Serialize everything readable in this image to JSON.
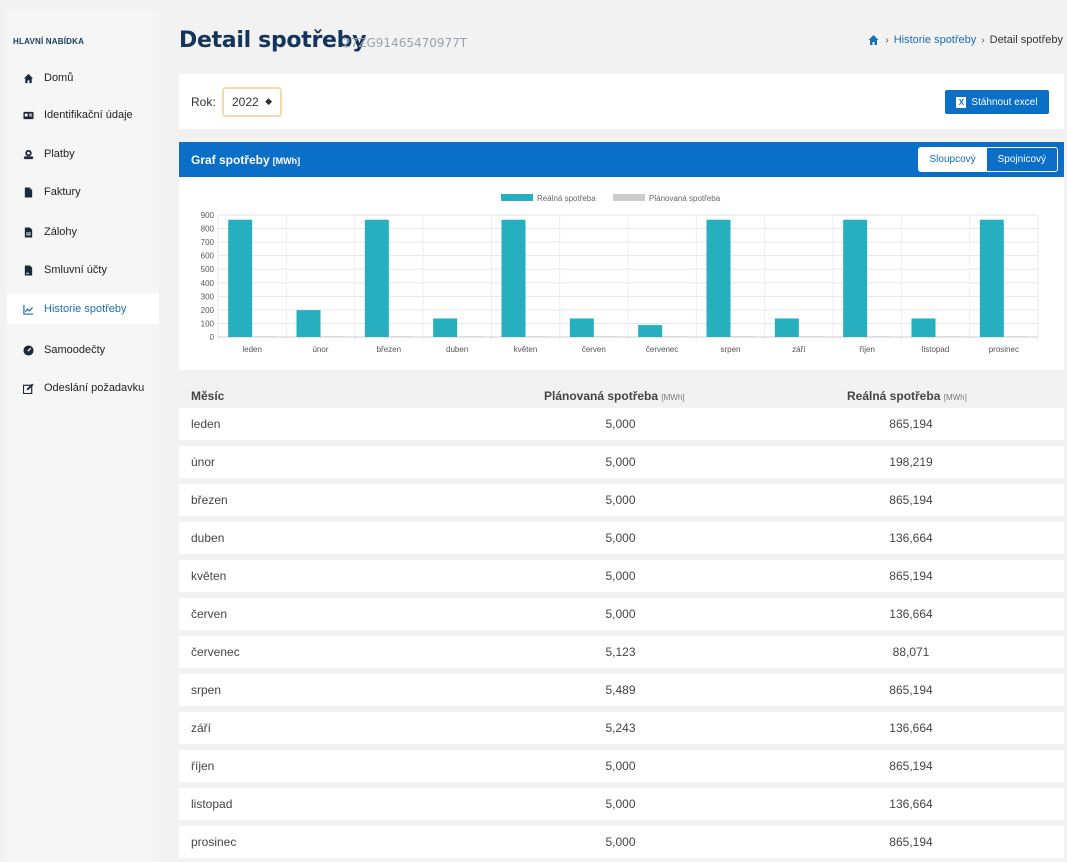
{
  "sidebar": {
    "header": "HLAVNÍ NABÍDKA",
    "items": [
      {
        "label": "Domů",
        "icon": "home-icon"
      },
      {
        "label": "Identifikační údaje",
        "icon": "id-card-icon"
      },
      {
        "label": "Platby",
        "icon": "payment-icon"
      },
      {
        "label": "Faktury",
        "icon": "invoice-icon"
      },
      {
        "label": "Zálohy",
        "icon": "deposit-icon"
      },
      {
        "label": "Smluvní účty",
        "icon": "contract-icon"
      },
      {
        "label": "Historie spotřeby",
        "icon": "line-chart-icon",
        "active": true
      },
      {
        "label": "Samoodečty",
        "icon": "gauge-icon"
      },
      {
        "label": "Odeslání požadavku",
        "icon": "edit-icon"
      }
    ]
  },
  "header": {
    "title": "Detail spotřeby",
    "subtitle": "27ZG91465470977T"
  },
  "breadcrumb": {
    "link": "Historie spotřeby",
    "current": "Detail spotřeby"
  },
  "filter": {
    "label": "Rok:",
    "year": "2022",
    "download_label": "Stáhnout excel"
  },
  "chart_card": {
    "title": "Graf spotřeby",
    "unit": "[MWh]",
    "toggle_bar": "Sloupcový",
    "toggle_line": "Spojnicový"
  },
  "chart_data": {
    "type": "bar",
    "categories": [
      "leden",
      "únor",
      "březen",
      "duben",
      "květen",
      "červen",
      "červenec",
      "srpen",
      "září",
      "říjen",
      "listopad",
      "prosinec"
    ],
    "series": [
      {
        "name": "Reálná spotřeba",
        "color": "#26afbf",
        "values": [
          865.194,
          198.219,
          865.194,
          136.664,
          865.194,
          136.664,
          88.071,
          865.194,
          136.664,
          865.194,
          136.664,
          865.194
        ]
      },
      {
        "name": "Plánovaná spotřeba",
        "color": "#cccccc",
        "values": [
          5.0,
          5.0,
          5.0,
          5.0,
          5.0,
          5.0,
          5.123,
          5.489,
          5.243,
          5.0,
          5.0,
          5.0
        ]
      }
    ],
    "yticks": [
      "900",
      "800",
      "700",
      "600",
      "500",
      "400",
      "300",
      "200",
      "100",
      "0"
    ],
    "ylim": [
      0,
      900
    ],
    "legend": "top-center",
    "grid": true
  },
  "table": {
    "col_month": "Měsíc",
    "col_planned": "Plánovaná spotřeba",
    "col_real": "Reálná spotřeba",
    "unit": "[MWh]",
    "rows": [
      {
        "month": "leden",
        "planned": "5,000",
        "real": "865,194"
      },
      {
        "month": "únor",
        "planned": "5,000",
        "real": "198,219"
      },
      {
        "month": "březen",
        "planned": "5,000",
        "real": "865,194"
      },
      {
        "month": "duben",
        "planned": "5,000",
        "real": "136,664"
      },
      {
        "month": "květen",
        "planned": "5,000",
        "real": "865,194"
      },
      {
        "month": "červen",
        "planned": "5,000",
        "real": "136,664"
      },
      {
        "month": "červenec",
        "planned": "5,123",
        "real": "88,071"
      },
      {
        "month": "srpen",
        "planned": "5,489",
        "real": "865,194"
      },
      {
        "month": "září",
        "planned": "5,243",
        "real": "136,664"
      },
      {
        "month": "říjen",
        "planned": "5,000",
        "real": "865,194"
      },
      {
        "month": "listopad",
        "planned": "5,000",
        "real": "136,664"
      },
      {
        "month": "prosinec",
        "planned": "5,000",
        "real": "865,194"
      }
    ]
  }
}
